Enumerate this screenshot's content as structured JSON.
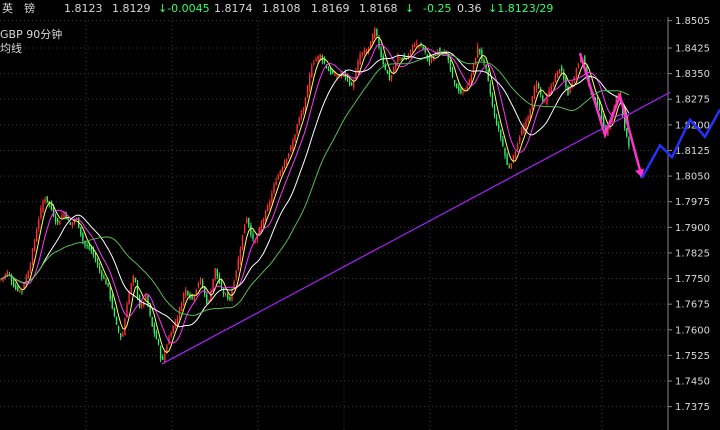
{
  "quote_bar": {
    "name": "英　镑",
    "last": "1.8123",
    "ask": "1.8129",
    "change": "↓-0.0045",
    "open": "1.8174",
    "low": "1.8108",
    "high": "1.8169",
    "prev": "1.8168",
    "pct_arrow": "↓",
    "pct": "-0.25",
    "amp": "0.36",
    "time_price": "↓1.8123/29"
  },
  "chart_label": {
    "symbol_period": "GBP  90分钟",
    "line2": "均线"
  },
  "chart_data": {
    "type": "candlestick",
    "title": "GBP 90分钟",
    "ylim": [
      1.7715,
      1.8475
    ],
    "y_ticks": [
      "1.8505",
      "1.8425",
      "1.8350",
      "1.8275",
      "1.8200",
      "1.8125",
      "1.8050",
      "1.7975",
      "1.7900",
      "1.7825",
      "1.7750",
      "1.7675",
      "1.7600",
      "1.7525",
      "1.7450",
      "1.7375"
    ],
    "grid": true,
    "price_path": [
      [
        0,
        1.7745
      ],
      [
        8,
        1.777
      ],
      [
        15,
        1.772
      ],
      [
        22,
        1.7715
      ],
      [
        30,
        1.779
      ],
      [
        38,
        1.7915
      ],
      [
        44,
        1.799
      ],
      [
        50,
        1.7965
      ],
      [
        57,
        1.791
      ],
      [
        64,
        1.7945
      ],
      [
        70,
        1.7905
      ],
      [
        76,
        1.793
      ],
      [
        84,
        1.785
      ],
      [
        92,
        1.783
      ],
      [
        100,
        1.777
      ],
      [
        108,
        1.7725
      ],
      [
        116,
        1.7615
      ],
      [
        122,
        1.757
      ],
      [
        128,
        1.77
      ],
      [
        134,
        1.776
      ],
      [
        140,
        1.766
      ],
      [
        146,
        1.77
      ],
      [
        152,
        1.761
      ],
      [
        158,
        1.756
      ],
      [
        162,
        1.75
      ],
      [
        170,
        1.759
      ],
      [
        178,
        1.764
      ],
      [
        185,
        1.772
      ],
      [
        192,
        1.769
      ],
      [
        200,
        1.775
      ],
      [
        208,
        1.767
      ],
      [
        215,
        1.778
      ],
      [
        222,
        1.771
      ],
      [
        230,
        1.769
      ],
      [
        238,
        1.78
      ],
      [
        246,
        1.7935
      ],
      [
        254,
        1.785
      ],
      [
        260,
        1.79
      ],
      [
        268,
        1.796
      ],
      [
        276,
        1.804
      ],
      [
        284,
        1.809
      ],
      [
        292,
        1.814
      ],
      [
        298,
        1.821
      ],
      [
        304,
        1.825
      ],
      [
        312,
        1.838
      ],
      [
        320,
        1.8405
      ],
      [
        328,
        1.836
      ],
      [
        336,
        1.834
      ],
      [
        344,
        1.835
      ],
      [
        352,
        1.831
      ],
      [
        360,
        1.8405
      ],
      [
        368,
        1.842
      ],
      [
        375,
        1.848
      ],
      [
        382,
        1.839
      ],
      [
        390,
        1.833
      ],
      [
        398,
        1.84
      ],
      [
        406,
        1.839
      ],
      [
        414,
        1.844
      ],
      [
        422,
        1.843
      ],
      [
        430,
        1.838
      ],
      [
        438,
        1.842
      ],
      [
        446,
        1.841
      ],
      [
        454,
        1.832
      ],
      [
        462,
        1.829
      ],
      [
        470,
        1.833
      ],
      [
        478,
        1.843
      ],
      [
        486,
        1.836
      ],
      [
        494,
        1.823
      ],
      [
        502,
        1.815
      ],
      [
        508,
        1.807
      ],
      [
        514,
        1.811
      ],
      [
        520,
        1.817
      ],
      [
        528,
        1.822
      ],
      [
        536,
        1.833
      ],
      [
        544,
        1.826
      ],
      [
        552,
        1.832
      ],
      [
        560,
        1.837
      ],
      [
        568,
        1.829
      ],
      [
        576,
        1.836
      ],
      [
        582,
        1.841
      ],
      [
        590,
        1.83
      ],
      [
        598,
        1.826
      ],
      [
        606,
        1.817
      ],
      [
        612,
        1.823
      ],
      [
        618,
        1.83
      ],
      [
        624,
        1.82
      ],
      [
        630,
        1.813
      ]
    ],
    "trendline": {
      "from": [
        162,
        1.75
      ],
      "to": [
        670,
        1.8295
      ]
    },
    "pattern_line": [
      [
        580,
        1.841
      ],
      [
        605,
        1.817
      ],
      [
        620,
        1.8285
      ],
      [
        642,
        1.8045
      ]
    ],
    "projection_line": [
      [
        642,
        1.8045
      ],
      [
        660,
        1.814
      ],
      [
        672,
        1.8105
      ],
      [
        690,
        1.8215
      ],
      [
        705,
        1.8165
      ],
      [
        720,
        1.8245
      ]
    ],
    "series_colors": {
      "candle_up": "#ff3030",
      "candle_down": "#33ee66",
      "ma_fast": "#ffff66",
      "ma_mid": "#ff33ff",
      "ma_slow": "#ffffff",
      "ma_long": "#55bb55",
      "trend": "#aa22ff",
      "pattern": "#ff33cc",
      "projection": "#2233ff"
    }
  }
}
